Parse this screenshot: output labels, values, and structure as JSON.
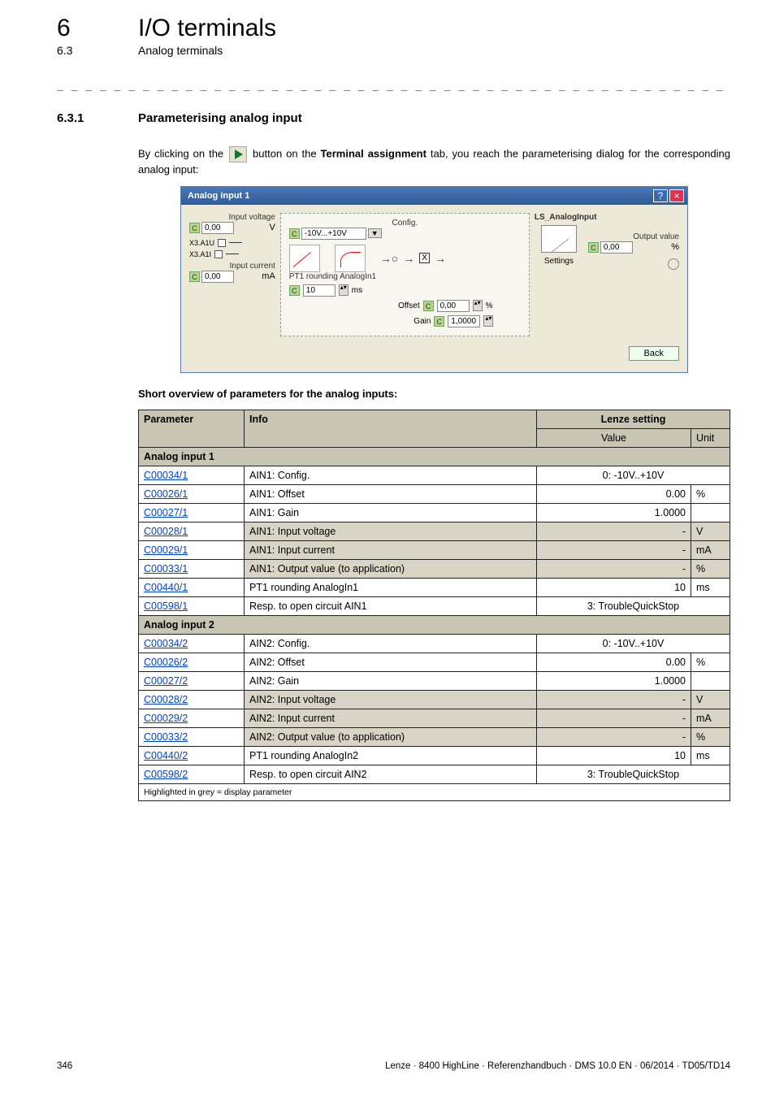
{
  "chapter": {
    "num": "6",
    "title": "I/O terminals"
  },
  "section": {
    "num": "6.3",
    "title": "Analog terminals"
  },
  "dashline": "_ _ _ _ _ _ _ _ _ _ _ _ _ _ _ _ _ _ _ _ _ _ _ _ _ _ _ _ _ _ _ _ _ _ _ _ _ _ _ _ _ _ _ _ _ _ _ _ _ _ _ _ _ _ _ _ _ _ _ _ _ _ _ _",
  "subhead": {
    "num": "6.3.1",
    "title": "Parameterising analog input"
  },
  "intro": {
    "pre": "By clicking on the ",
    "mid1": " button on the ",
    "tab_label": "Terminal assignment",
    "mid2": "  tab, you reach the parameterising dialog for the corresponding analog input:"
  },
  "dialog": {
    "title": "Analog input 1",
    "c_symbol": "C",
    "left": {
      "input_voltage_lbl": "Input voltage",
      "input_voltage_val": "0,00",
      "input_voltage_unit": "V",
      "term1": "X3.A1U",
      "term2": "X3.A1I",
      "input_current_lbl": "Input current",
      "input_current_val": "0,00",
      "input_current_unit": "mA"
    },
    "mid": {
      "config_lbl": "Config.",
      "config_val": "-10V...+10V",
      "pt1_lbl": "PT1 rounding AnalogIn1",
      "pt1_val": "10",
      "pt1_unit": "ms",
      "offset_lbl": "Offset",
      "offset_val": "0,00",
      "offset_unit": "%",
      "gain_lbl": "Gain",
      "gain_val": "1,0000",
      "node_x": "X",
      "ls_lbl": "LS_AnalogInput",
      "settings_lbl": "Settings"
    },
    "right": {
      "output_lbl": "Output value",
      "output_val": "0,00",
      "output_unit": "%"
    },
    "back_btn": "Back"
  },
  "overview_head": "Short overview of parameters for the analog inputs:",
  "table": {
    "headers": {
      "param": "Parameter",
      "info": "Info",
      "lenze": "Lenze setting",
      "value": "Value",
      "unit": "Unit"
    },
    "group1": "Analog input 1",
    "group2": "Analog input 2",
    "rows1": [
      {
        "p": "C00034/1",
        "info": "AIN1: Config.",
        "value": "0: -10V..+10V",
        "unit": "",
        "span": true
      },
      {
        "p": "C00026/1",
        "info": "AIN1: Offset",
        "value": "0.00",
        "unit": "%"
      },
      {
        "p": "C00027/1",
        "info": "AIN1: Gain",
        "value": "1.0000",
        "unit": ""
      },
      {
        "p": "C00028/1",
        "info": "AIN1: Input voltage",
        "value": "-",
        "unit": "V",
        "grey": true
      },
      {
        "p": "C00029/1",
        "info": "AIN1: Input current",
        "value": "-",
        "unit": "mA",
        "grey": true
      },
      {
        "p": "C00033/1",
        "info": "AIN1: Output value (to application)",
        "value": "-",
        "unit": "%",
        "grey": true
      },
      {
        "p": "C00440/1",
        "info": "PT1 rounding AnalogIn1",
        "value": "10",
        "unit": "ms"
      },
      {
        "p": "C00598/1",
        "info": "Resp. to open circuit AIN1",
        "value": "3: TroubleQuickStop",
        "unit": "",
        "span": true
      }
    ],
    "rows2": [
      {
        "p": "C00034/2",
        "info": "AIN2: Config.",
        "value": "0: -10V..+10V",
        "unit": "",
        "span": true
      },
      {
        "p": "C00026/2",
        "info": "AIN2: Offset",
        "value": "0.00",
        "unit": "%"
      },
      {
        "p": "C00027/2",
        "info": "AIN2: Gain",
        "value": "1.0000",
        "unit": ""
      },
      {
        "p": "C00028/2",
        "info": "AIN2: Input voltage",
        "value": "-",
        "unit": "V",
        "grey": true
      },
      {
        "p": "C00029/2",
        "info": "AIN2: Input current",
        "value": "-",
        "unit": "mA",
        "grey": true
      },
      {
        "p": "C00033/2",
        "info": "AIN2: Output value (to application)",
        "value": "-",
        "unit": "%",
        "grey": true
      },
      {
        "p": "C00440/2",
        "info": "PT1 rounding AnalogIn2",
        "value": "10",
        "unit": "ms"
      },
      {
        "p": "C00598/2",
        "info": "Resp. to open circuit AIN2",
        "value": "3: TroubleQuickStop",
        "unit": "",
        "span": true
      }
    ],
    "footnote": "Highlighted in grey = display parameter"
  },
  "footer": {
    "page": "346",
    "right": "Lenze · 8400 HighLine · Referenzhandbuch · DMS 10.0 EN · 06/2014 · TD05/TD14"
  }
}
